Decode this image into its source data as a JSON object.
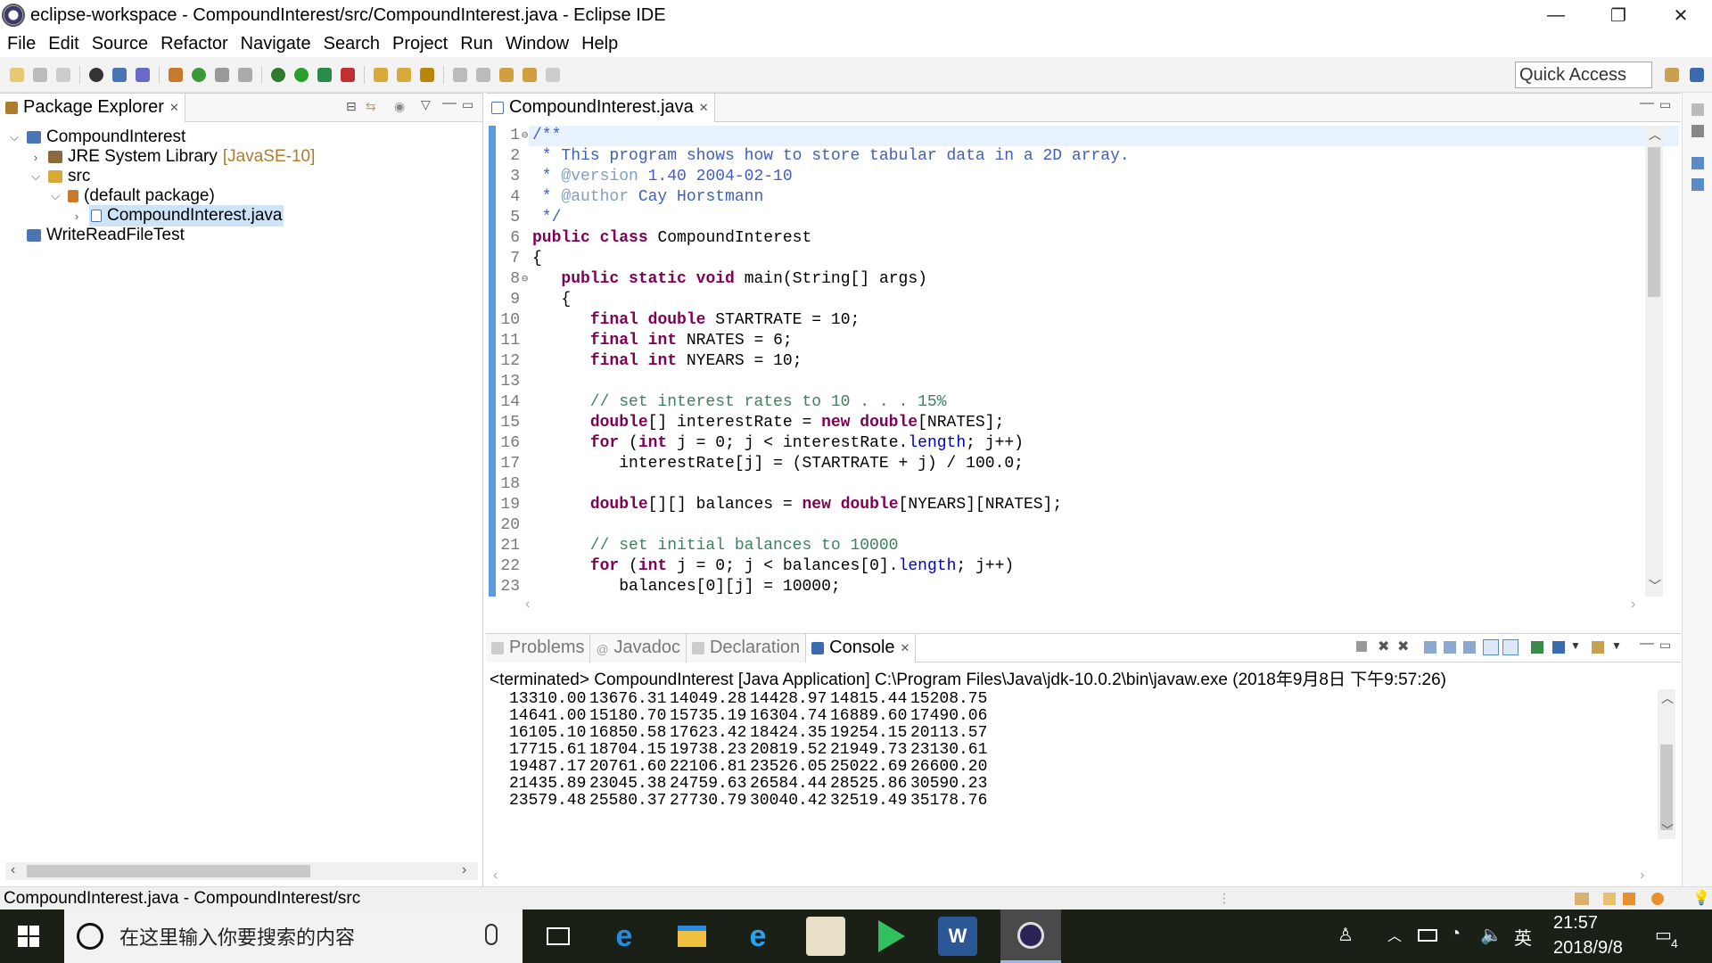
{
  "window": {
    "title": "eclipse-workspace - CompoundInterest/src/CompoundInterest.java - Eclipse IDE",
    "controls": [
      "—",
      "❐",
      "✕"
    ]
  },
  "menu": [
    "File",
    "Edit",
    "Source",
    "Refactor",
    "Navigate",
    "Search",
    "Project",
    "Run",
    "Window",
    "Help"
  ],
  "toolbar": {
    "quick_access": "Quick Access"
  },
  "package_explorer": {
    "tab_label": "Package Explorer",
    "tree": [
      {
        "label": "CompoundInterest",
        "expanded": true,
        "icon": "project-icon"
      },
      {
        "label": "JRE System Library",
        "decoration": "[JavaSE-10]",
        "icon": "library-icon"
      },
      {
        "label": "src",
        "icon": "source-folder-icon"
      },
      {
        "label": "(default package)",
        "icon": "package-icon"
      },
      {
        "label": "CompoundInterest.java",
        "icon": "java-file-icon",
        "selected": true
      },
      {
        "label": "WriteReadFileTest",
        "icon": "project-icon"
      }
    ]
  },
  "editor": {
    "tab_label": "CompoundInterest.java",
    "lines": [
      {
        "n": "1",
        "t": "/**"
      },
      {
        "n": "2",
        "t": " * This program shows how to store tabular data in a 2D array."
      },
      {
        "n": "3",
        "t": " * @version 1.40 2004-02-10"
      },
      {
        "n": "4",
        "t": " * @author Cay Horstmann"
      },
      {
        "n": "5",
        "t": " */"
      },
      {
        "n": "6",
        "t": "public class CompoundInterest"
      },
      {
        "n": "7",
        "t": "{"
      },
      {
        "n": "8",
        "t": "   public static void main(String[] args)"
      },
      {
        "n": "9",
        "t": "   {"
      },
      {
        "n": "10",
        "t": "      final double STARTRATE = 10;"
      },
      {
        "n": "11",
        "t": "      final int NRATES = 6;"
      },
      {
        "n": "12",
        "t": "      final int NYEARS = 10;"
      },
      {
        "n": "13",
        "t": ""
      },
      {
        "n": "14",
        "t": "      // set interest rates to 10 . . . 15%"
      },
      {
        "n": "15",
        "t": "      double[] interestRate = new double[NRATES];"
      },
      {
        "n": "16",
        "t": "      for (int j = 0; j < interestRate.length; j++)"
      },
      {
        "n": "17",
        "t": "         interestRate[j] = (STARTRATE + j) / 100.0;"
      },
      {
        "n": "18",
        "t": ""
      },
      {
        "n": "19",
        "t": "      double[][] balances = new double[NYEARS][NRATES];"
      },
      {
        "n": "20",
        "t": ""
      },
      {
        "n": "21",
        "t": "      // set initial balances to 10000"
      },
      {
        "n": "22",
        "t": "      for (int j = 0; j < balances[0].length; j++)"
      },
      {
        "n": "23",
        "t": "         balances[0][j] = 10000;"
      }
    ]
  },
  "bottom_tabs": [
    "Problems",
    "Javadoc",
    "Declaration",
    "Console"
  ],
  "console": {
    "header": "<terminated> CompoundInterest [Java Application] C:\\Program Files\\Java\\jdk-10.0.2\\bin\\javaw.exe (2018年9月8日 下午9:57:26)",
    "rows": [
      [
        "13310.00",
        "13676.31",
        "14049.28",
        "14428.97",
        "14815.44",
        "15208.75"
      ],
      [
        "14641.00",
        "15180.70",
        "15735.19",
        "16304.74",
        "16889.60",
        "17490.06"
      ],
      [
        "16105.10",
        "16850.58",
        "17623.42",
        "18424.35",
        "19254.15",
        "20113.57"
      ],
      [
        "17715.61",
        "18704.15",
        "19738.23",
        "20819.52",
        "21949.73",
        "23130.61"
      ],
      [
        "19487.17",
        "20761.60",
        "22106.81",
        "23526.05",
        "25022.69",
        "26600.20"
      ],
      [
        "21435.89",
        "23045.38",
        "24759.63",
        "26584.44",
        "28525.86",
        "30590.23"
      ],
      [
        "23579.48",
        "25580.37",
        "27730.79",
        "30040.42",
        "32519.49",
        "35178.76"
      ]
    ]
  },
  "status": {
    "text": "CompoundInterest.java - CompoundInterest/src"
  },
  "taskbar": {
    "search_placeholder": "在这里输入你要搜索的内容",
    "time": "21:57",
    "date": "2018/9/8",
    "ime": "英",
    "notification_count": "4"
  }
}
